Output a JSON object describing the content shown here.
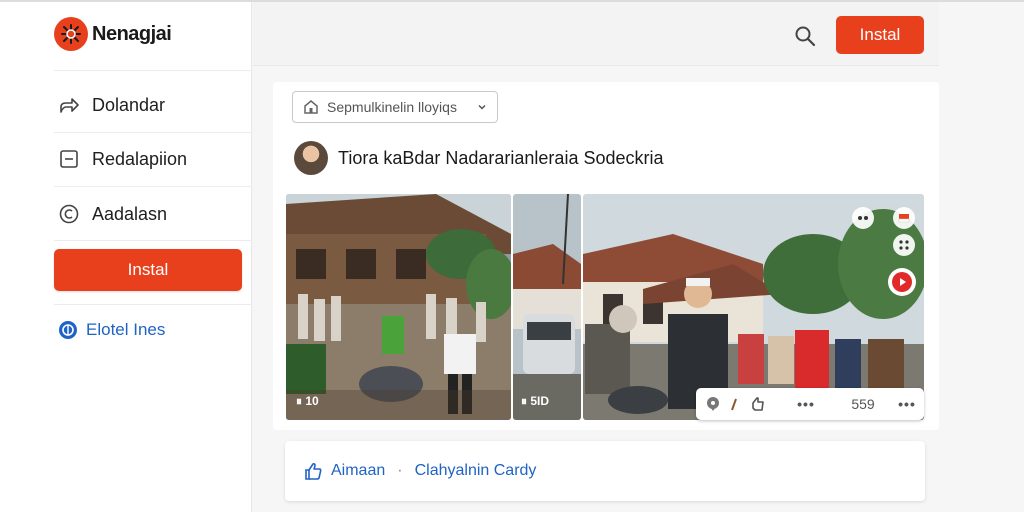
{
  "app": {
    "name": "Nenagjai",
    "brand_color": "#e8401c",
    "link_color": "#1f63c4"
  },
  "sidebar": {
    "items": [
      {
        "label": "Dolandar",
        "icon": "share-arrow-icon"
      },
      {
        "label": "Redalapiion",
        "icon": "square-minus-icon"
      },
      {
        "label": "Aadalasn",
        "icon": "circle-c-icon"
      }
    ],
    "install_label": "Instal",
    "link_label": "Elotel Ines",
    "link_icon": "globe-badge-icon"
  },
  "header": {
    "search_icon": "search-icon",
    "install_label": "Instal"
  },
  "post": {
    "dropdown_value": "Sepmulkinelin lloyiqs",
    "title": "Tiora kaBdar Nadararianleraia Sodeckria",
    "video_a_label": "⏸ 10",
    "video_b_label": "⏸ 5ID",
    "actionbar": {
      "more_left": "•••",
      "count": "559",
      "more_right": "•••"
    }
  },
  "footer": {
    "like_label": "Aimaan",
    "separator": "·",
    "link_label": "Clahyalnin Cardy"
  }
}
